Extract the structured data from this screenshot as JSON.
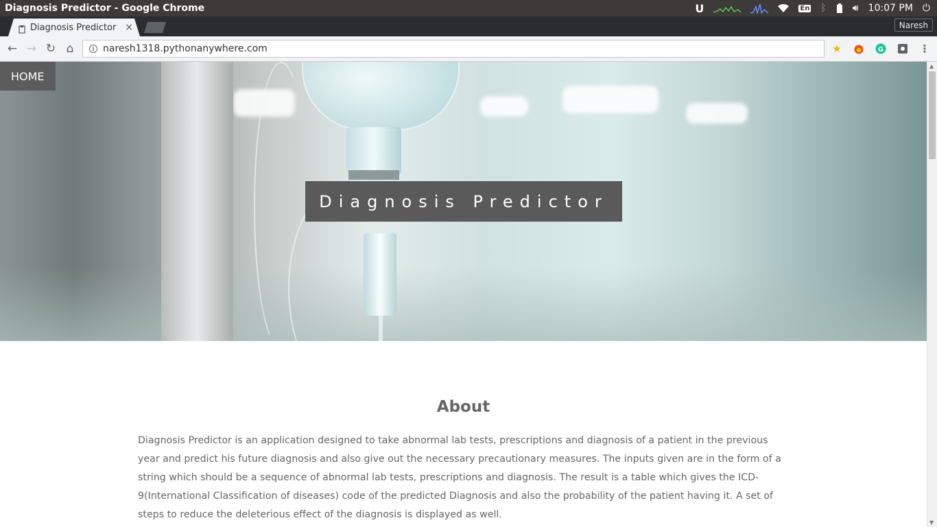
{
  "window": {
    "title": "Diagnosis Predictor - Google Chrome",
    "tray": {
      "keyboard": "En",
      "time": "10:07 PM"
    }
  },
  "browser": {
    "tab_title": "Diagnosis Predictor",
    "profile_name": "Naresh",
    "url": "naresh1318.pythonanywhere.com"
  },
  "page": {
    "nav_home": "HOME",
    "hero_title": "Diagnosis Predictor",
    "about_heading": "About",
    "about_text": "Diagnosis Predictor is an application designed to take abnormal lab tests, prescriptions and diagnosis of a patient in the previous year and predict his future diagnosis and also give out the necessary precautionary measures. The inputs given are in the form of a string which should be a sequence of abnormal lab tests, prescriptions and diagnosis. The result is a table which gives the ICD-9(International Classification of diseases) code of the predicted Diagnosis and also the probability of the patient having it. A set of steps to reduce the deleterious effect of the diagnosis is displayed as well."
  },
  "colors": {
    "os_bar": "#3c3b37",
    "tab_strip": "#2b2c30",
    "toolbar": "#f1f3f4",
    "hero_overlay": "#5a5a5a",
    "text": "#666666"
  }
}
